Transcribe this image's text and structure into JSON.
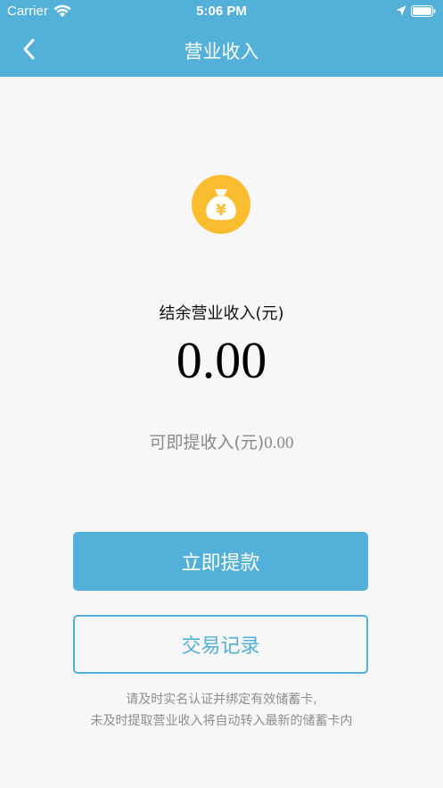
{
  "status_bar": {
    "carrier": "Carrier",
    "time": "5:06 PM",
    "icons": [
      "wifi-icon",
      "location-arrow-icon",
      "battery-icon"
    ]
  },
  "nav": {
    "title": "营业收入",
    "back_icon": "chevron-left-icon"
  },
  "summary": {
    "icon": "money-bag-yuan-icon",
    "icon_symbol": "¥",
    "balance_label": "结余营业收入(元)",
    "balance_value": "0.00",
    "withdrawable_label": "可即提收入(元)",
    "withdrawable_value": "0.00"
  },
  "actions": {
    "withdraw_label": "立即提款",
    "records_label": "交易记录"
  },
  "notice": {
    "line1": "请及时实名认证并绑定有效储蓄卡,",
    "line2": "未及时提取营业收入将自动转入最新的储蓄卡内"
  },
  "colors": {
    "accent": "#52b0d9",
    "coin": "#f9bd2f",
    "background": "#f7f7f7"
  }
}
